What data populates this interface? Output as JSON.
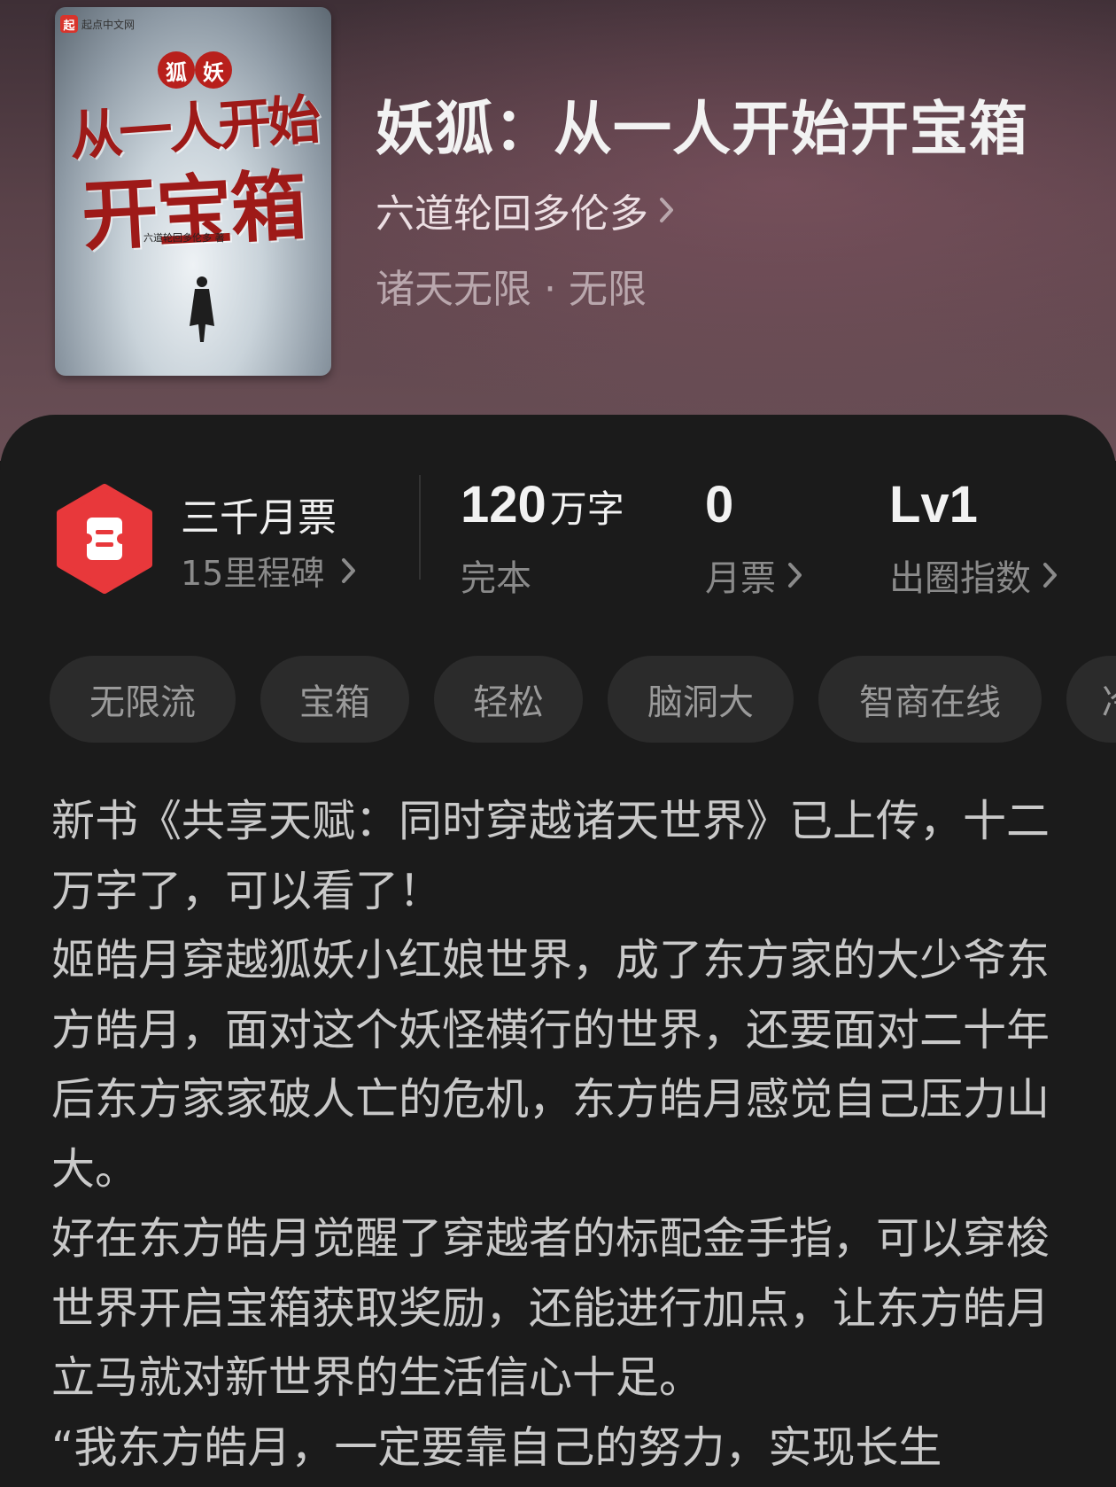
{
  "book": {
    "title": "妖狐：从一人开始开宝箱",
    "author": "六道轮回多伦多",
    "genre": "诸天无限 · 无限"
  },
  "cover": {
    "brand": "起点中文网",
    "brand_logo": "起",
    "badge_left": "狐",
    "badge_right": "妖",
    "title_line1": "从一人开始",
    "title_line2": "开宝箱",
    "author_small": "六道轮回多伦多 著"
  },
  "stats": {
    "ticket_title": "三千月票",
    "milestone": "15里程碑",
    "word_count": "120",
    "word_unit": "万字",
    "status": "完本",
    "monthly_votes": "0",
    "monthly_votes_label": "月票",
    "level": "Lv1",
    "level_label": "出圈指数"
  },
  "tags": [
    "无限流",
    "宝箱",
    "轻松",
    "脑洞大",
    "智商在线",
    "冷"
  ],
  "description": {
    "paragraphs": [
      "新书《共享天赋：同时穿越诸天世界》已上传，十二万字了，可以看了！",
      "姬皓月穿越狐妖小红娘世界，成了东方家的大少爷东方皓月，面对这个妖怪横行的世界，还要面对二十年后东方家家破人亡的危机，东方皓月感觉自己压力山大。",
      "好在东方皓月觉醒了穿越者的标配金手指，可以穿梭世界开启宝箱获取奖励，还能进行加点，让东方皓月立马就对新世界的生活信心十足。",
      "“我东方皓月，一定要靠自己的努力，实现长生"
    ]
  },
  "colors": {
    "accent_red": "#e8383b",
    "card_bg": "#1b1b1b",
    "tag_bg": "#2b2b2b"
  },
  "icons": {
    "ticket": "ticket-icon",
    "chevron": "chevron-right-icon"
  }
}
